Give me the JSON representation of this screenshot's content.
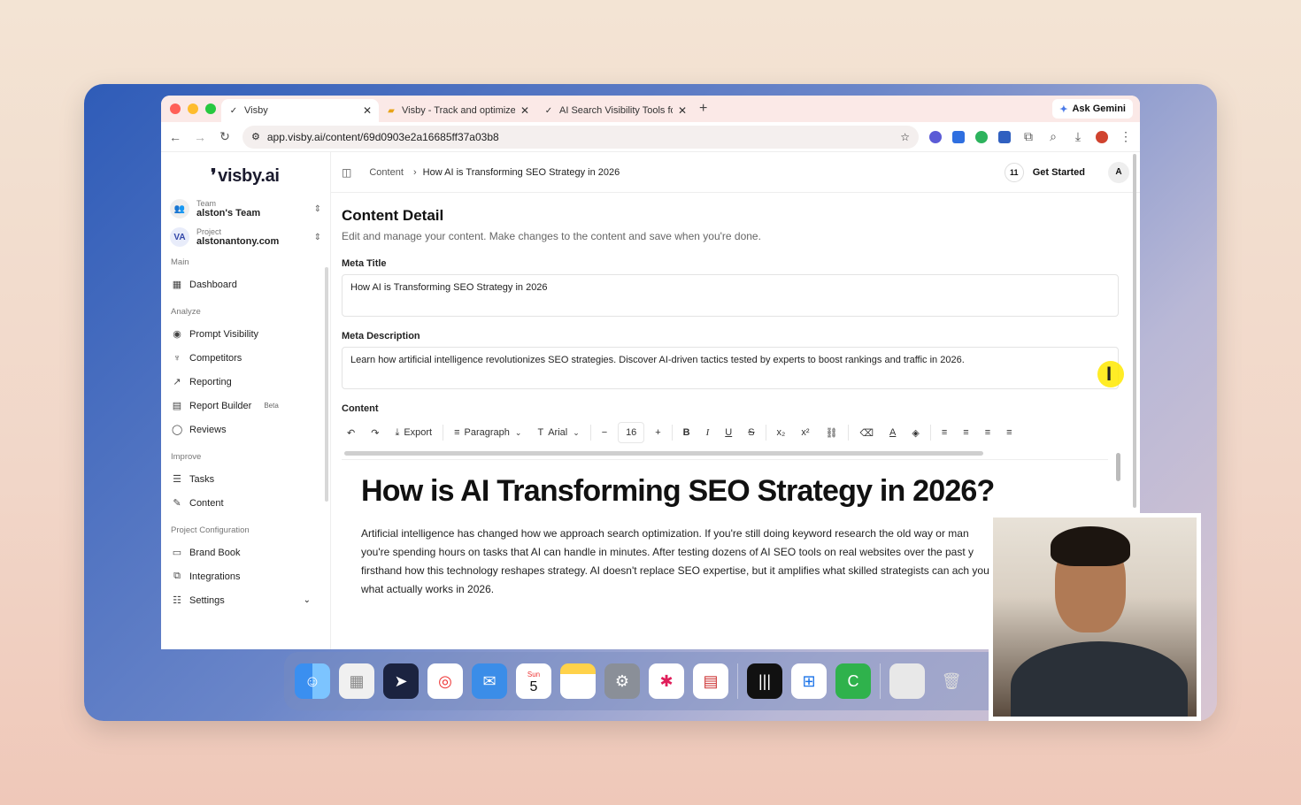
{
  "browser": {
    "tabs": [
      {
        "title": "Visby",
        "active": true
      },
      {
        "title": "Visby - Track and optimize AI",
        "active": false
      },
      {
        "title": "AI Search Visibility Tools for E",
        "active": false
      }
    ],
    "gemini_label": "Ask Gemini",
    "url": "app.visby.ai/content/69d0903e2a16685ff37a03b8"
  },
  "sidebar": {
    "logo": "visby.ai",
    "team": {
      "caption": "Team",
      "value": "alston's Team"
    },
    "project": {
      "caption": "Project",
      "value": "alstonantony.com"
    },
    "sections": [
      {
        "title": "Main",
        "items": [
          {
            "label": "Dashboard",
            "icon": "grid-icon"
          }
        ]
      },
      {
        "title": "Analyze",
        "items": [
          {
            "label": "Prompt Visibility",
            "icon": "eye-icon"
          },
          {
            "label": "Competitors",
            "icon": "trophy-icon"
          },
          {
            "label": "Reporting",
            "icon": "chart-icon"
          },
          {
            "label": "Report Builder",
            "icon": "builder-icon",
            "badge": "Beta"
          },
          {
            "label": "Reviews",
            "icon": "chat-icon"
          }
        ]
      },
      {
        "title": "Improve",
        "items": [
          {
            "label": "Tasks",
            "icon": "list-icon"
          },
          {
            "label": "Content",
            "icon": "edit-icon"
          }
        ]
      },
      {
        "title": "Project Configuration",
        "items": [
          {
            "label": "Brand Book",
            "icon": "book-icon"
          },
          {
            "label": "Integrations",
            "icon": "puzzle-icon"
          },
          {
            "label": "Settings",
            "icon": "sliders-icon"
          }
        ]
      }
    ]
  },
  "header": {
    "crumb_root": "Content",
    "crumb_current": "How AI is Transforming SEO Strategy in 2026",
    "count": "11",
    "get_started": "Get Started",
    "avatar": "A"
  },
  "page": {
    "title": "Content Detail",
    "subtitle": "Edit and manage your content. Make changes to the content and save when you're done.",
    "meta_title_label": "Meta Title",
    "meta_title_value": "How AI is Transforming SEO Strategy in 2026",
    "meta_desc_label": "Meta Description",
    "meta_desc_value": "Learn how artificial intelligence revolutionizes SEO strategies. Discover AI-driven tactics tested by experts to boost rankings and traffic in 2026.",
    "content_label": "Content"
  },
  "toolbar": {
    "export": "Export",
    "block_type": "Paragraph",
    "font": "Arial",
    "font_size": "16"
  },
  "editor": {
    "heading": "How is AI Transforming SEO Strategy in 2026?",
    "paragraph": "Artificial intelligence has changed how we approach search optimization. If you're still doing keyword research the old way or man you're spending hours on tasks that AI can handle in minutes. After testing dozens of AI SEO tools on real websites over the past y firsthand how this technology reshapes strategy. AI doesn't replace SEO expertise, but it amplifies what skilled strategists can ach you what actually works in 2026."
  },
  "dock": {
    "calendar_month": "Sun",
    "calendar_day": "5"
  },
  "colors": {
    "accent": "#1b1b2e",
    "tab_bar": "#fbe9e7",
    "cursor_highlight": "#ffe900"
  }
}
